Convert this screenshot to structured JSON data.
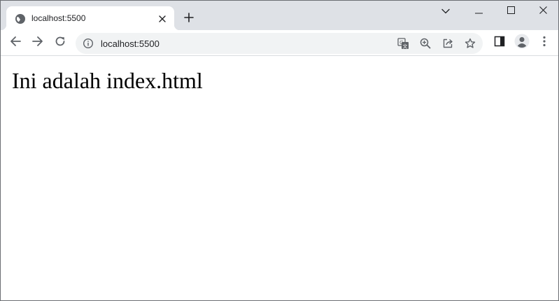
{
  "tab": {
    "title": "localhost:5500",
    "favicon_icon": "globe-icon",
    "close_icon": "close-icon"
  },
  "new_tab_icon": "plus-icon",
  "window_controls": [
    "tab-search-icon",
    "minimize-icon",
    "maximize-icon",
    "close-icon"
  ],
  "toolbar": {
    "nav_icons": [
      "back-arrow-icon",
      "forward-arrow-icon",
      "reload-icon"
    ],
    "site_info_icon": "info-icon",
    "url": "localhost:5500",
    "omnibox_icons": [
      "translate-icon",
      "zoom-icon",
      "share-icon",
      "star-icon"
    ],
    "right_icons": [
      "side-panel-icon",
      "profile-icon",
      "kebab-menu-icon"
    ]
  },
  "page": {
    "heading": "Ini adalah index.html"
  },
  "colors": {
    "titlebar": "#dee1e6",
    "omnibox": "#f1f3f4",
    "icon": "#5f6368",
    "text": "#202124"
  }
}
